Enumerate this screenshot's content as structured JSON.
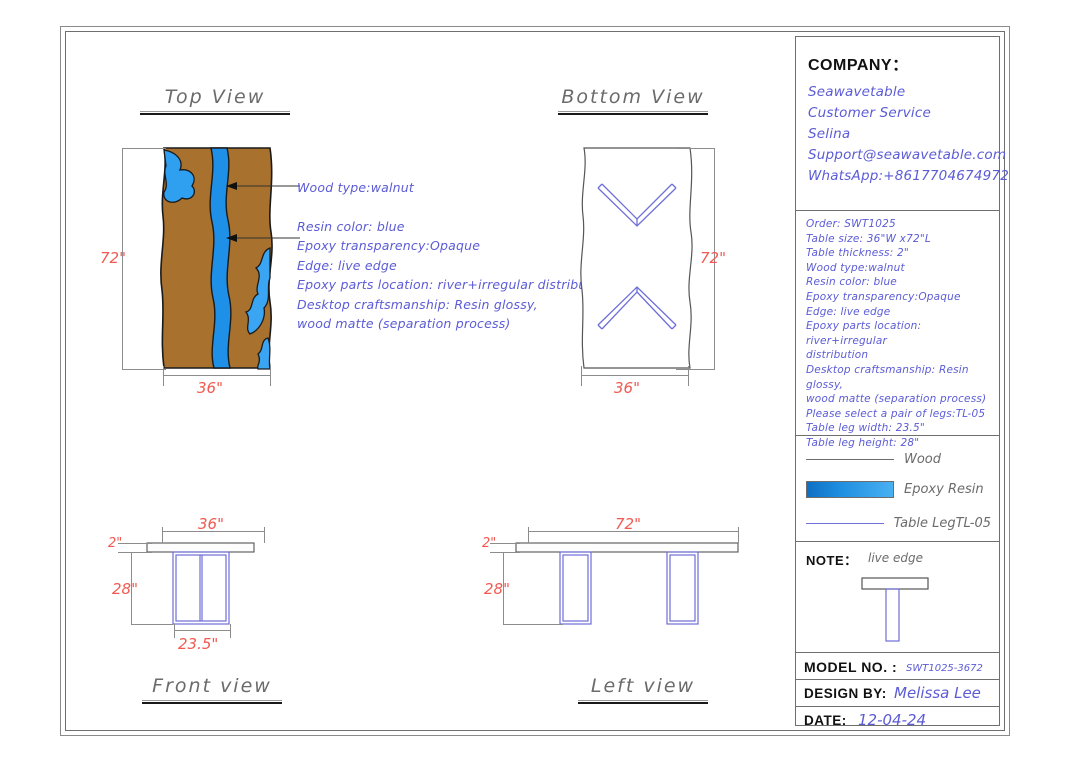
{
  "panel": {
    "company_label": "COMPANY：",
    "company_lines": [
      "Seawavetable",
      "Customer Service",
      "Selina",
      "Support@seawavetable.com",
      "WhatsApp:+8617704674972"
    ],
    "spec_lines": [
      "Order: SWT1025",
      "Table size: 36\"W x72\"L",
      "Table thickness: 2\"",
      "Wood type:walnut",
      "Resin color: blue",
      "Epoxy transparency:Opaque",
      "Edge: live edge",
      "Epoxy parts location: river+irregular",
      "distribution",
      "Desktop craftsmanship: Resin glossy,",
      "wood matte (separation process)",
      "Please select a pair of legs:TL-05",
      "Table leg width: 23.5\"",
      "Table leg height: 28\""
    ],
    "legend": [
      {
        "label": "Wood",
        "swatch": "wood-line-swatch"
      },
      {
        "label": "Epoxy Resin",
        "swatch": "resin-gradient-swatch"
      },
      {
        "label": "Table LegTL-05",
        "swatch": "leg-line-swatch"
      }
    ],
    "note_label": "NOTE：",
    "note_value": "live edge",
    "titleblock": [
      {
        "key": "MODEL NO. :",
        "value": "SWT1025-3672"
      },
      {
        "key": "DESIGN BY:",
        "value": "Melissa Lee"
      },
      {
        "key": "DATE:",
        "value": "12-04-24"
      }
    ]
  },
  "views": {
    "top": {
      "title": "Top View",
      "dim_height": "72\"",
      "dim_width": "36\""
    },
    "bottom": {
      "title": "Bottom View",
      "dim_height": "72\"",
      "dim_width": "36\""
    },
    "front": {
      "title": "Front view",
      "dim_width": "36\"",
      "dim_thickness": "2\"",
      "dim_height": "28\"",
      "dim_leg_width": "23.5\""
    },
    "left": {
      "title": "Left view",
      "dim_width": "72\"",
      "dim_thickness": "2\"",
      "dim_height": "28\""
    }
  },
  "annotations": {
    "callout_wood": "Wood type:walnut",
    "lines": [
      "Resin color: blue",
      "Epoxy transparency:Opaque",
      "Edge: live edge",
      "Epoxy parts location: river+irregular distribution",
      "Desktop craftsmanship: Resin glossy,",
      " wood matte (separation process)"
    ]
  },
  "colors": {
    "wood": "#a9712e",
    "resin": "#1e90e8",
    "resin_dark": "#0e6fc4",
    "leg": "#6f6fd8",
    "handwriting": "#5b5bd6",
    "dimension": "#f05a52",
    "line": "#8c8c8c"
  }
}
